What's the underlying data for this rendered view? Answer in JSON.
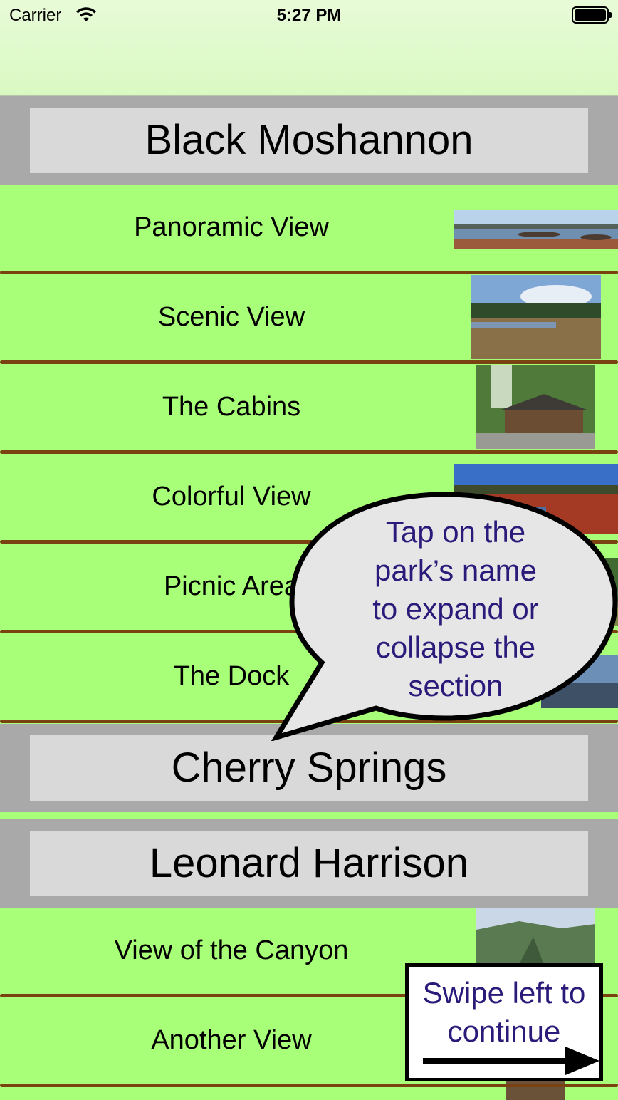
{
  "status_bar": {
    "carrier": "Carrier",
    "time": "5:27 PM"
  },
  "sections": [
    {
      "name": "Black Moshannon",
      "items": [
        "Panoramic View",
        "Scenic View",
        "The Cabins",
        "Colorful View",
        "Picnic Area",
        "The Dock"
      ]
    },
    {
      "name": "Cherry Springs",
      "items": []
    },
    {
      "name": "Leonard Harrison",
      "items": [
        "View of the Canyon",
        "Another View"
      ]
    }
  ],
  "tips": {
    "tap_hint": [
      "Tap on the",
      "park’s name",
      "to expand or",
      "collapse the",
      "section"
    ],
    "swipe_hint": [
      "Swipe left to",
      "continue"
    ]
  },
  "colors": {
    "row_bg": "#a8ff78",
    "separator": "#7a4210",
    "header_bg": "#a9a9a9",
    "tip_text": "#2c1a7a"
  }
}
